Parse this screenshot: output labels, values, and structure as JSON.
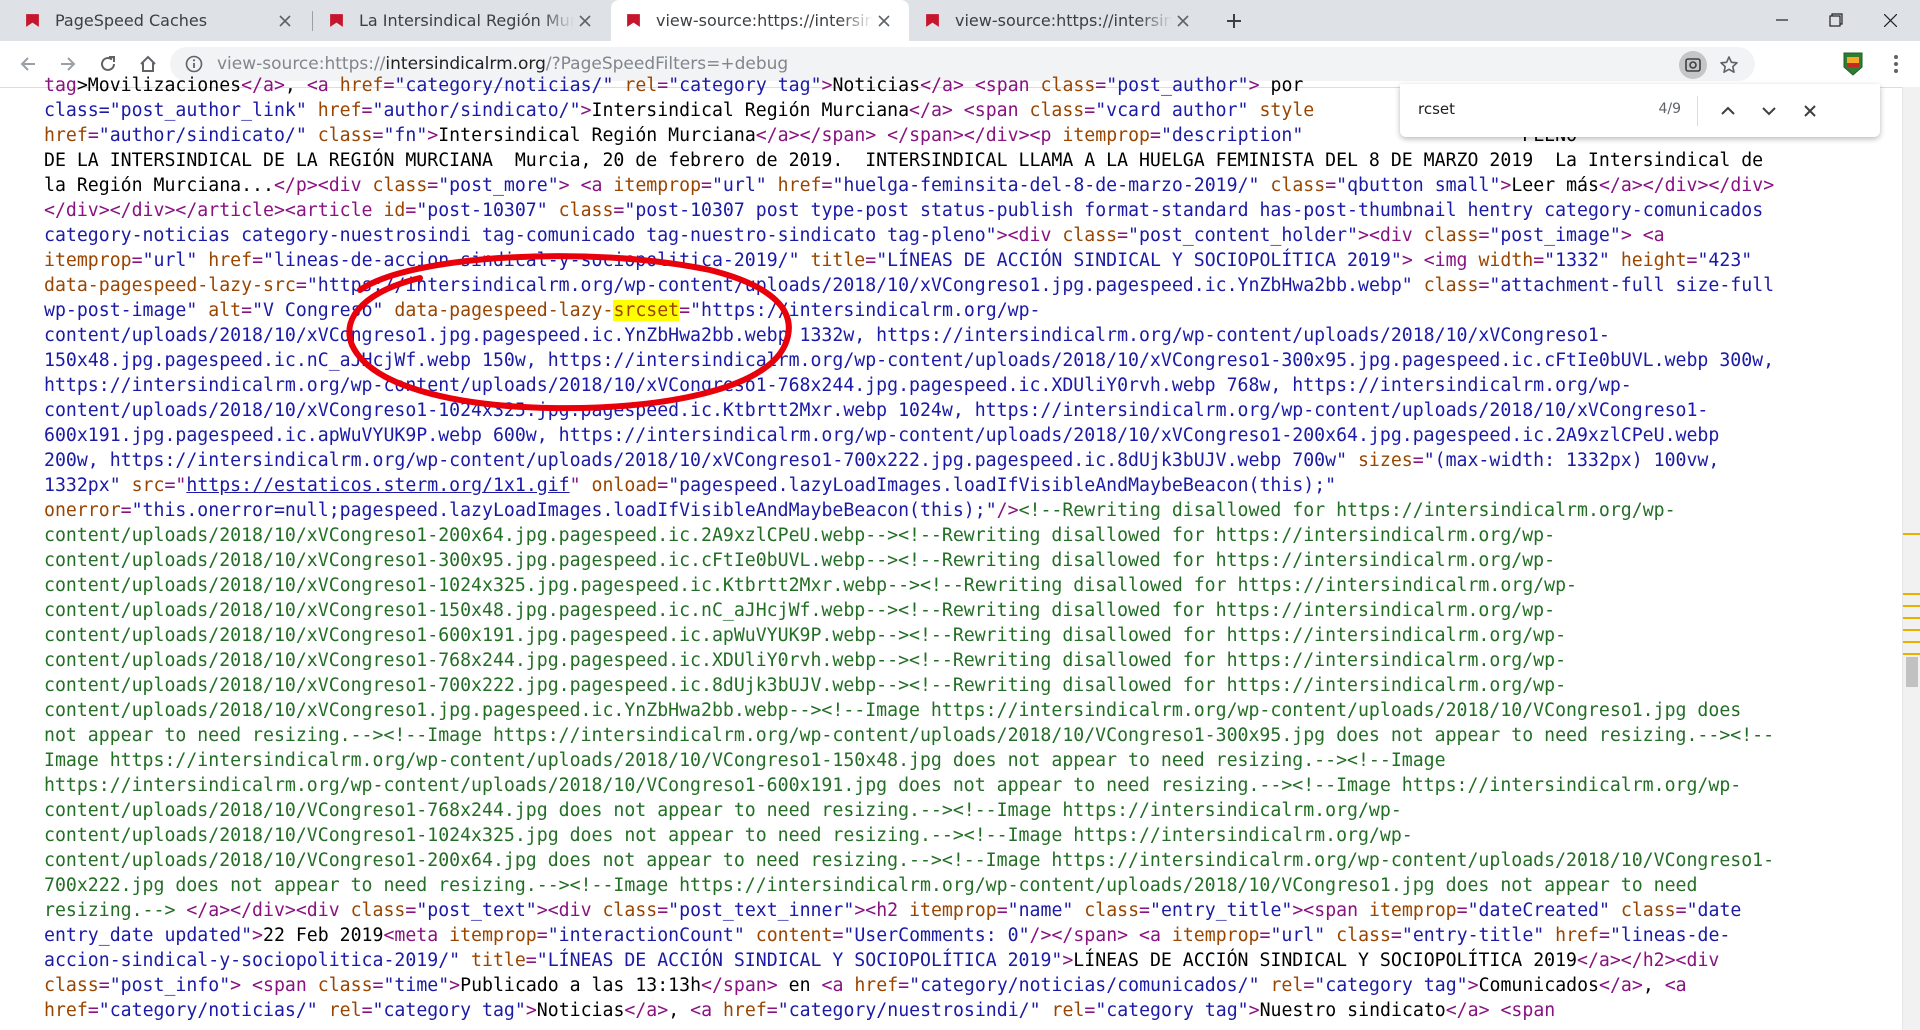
{
  "tabs": [
    {
      "title": "PageSpeed Caches",
      "active": false
    },
    {
      "title": "La Intersindical Región Murciana",
      "active": false
    },
    {
      "title": "view-source:https://intersindicalrm.org/?PageSpeedFilters=+debug",
      "active": true
    },
    {
      "title": "view-source:https://intersindicalrm.org/",
      "active": false
    }
  ],
  "omnibox": {
    "scheme": "view-source:https://",
    "host": "intersindicalrm.org",
    "path": "/?PageSpeedFilters=+debug"
  },
  "find": {
    "query": "rcset",
    "count": "4/9"
  },
  "colors": {
    "tag": "#881280",
    "attr": "#994500",
    "value": "#1a1aa6",
    "comment": "#236e25",
    "highlight": "#ffff00",
    "annotation": "#e8000b",
    "favicon": "#c5162e"
  },
  "icons": [
    "favicon",
    "close-icon",
    "plus-icon",
    "minimize-icon",
    "maximize-icon",
    "back-icon",
    "forward-icon",
    "reload-icon",
    "home-icon",
    "info-icon",
    "lens-icon",
    "star-icon",
    "extension-icon",
    "menu-icon",
    "chevron-up-icon",
    "chevron-down-icon"
  ],
  "source_lines": [
    [
      [
        "t",
        "tag"
      ],
      [
        "tx",
        "&gt;Movilizaciones"
      ],
      [
        "t",
        "&lt;/a&gt;"
      ],
      [
        "tx",
        ", "
      ],
      [
        "t",
        "&lt;a "
      ],
      [
        "a",
        "href"
      ],
      [
        "t",
        "="
      ],
      [
        "v",
        "\"category/noticias/\""
      ],
      [
        "a",
        " rel"
      ],
      [
        "t",
        "="
      ],
      [
        "v",
        "\"category tag\""
      ],
      [
        "t",
        "&gt;"
      ],
      [
        "tx",
        "Noticias"
      ],
      [
        "t",
        "&lt;/a&gt; &lt;span "
      ],
      [
        "a",
        "class"
      ],
      [
        "t",
        "="
      ],
      [
        "v",
        "\"post_author\""
      ],
      [
        "t",
        "&gt; "
      ],
      [
        "tx",
        "por"
      ]
    ],
    [
      [
        "v",
        "class=\"post_author_link\""
      ],
      [
        "a",
        " href"
      ],
      [
        "t",
        "="
      ],
      [
        "v",
        "\"author/sindicato/\""
      ],
      [
        "t",
        "&gt;"
      ],
      [
        "tx",
        "Intersindical Región Murciana"
      ],
      [
        "t",
        "&lt;/a&gt; &lt;span "
      ],
      [
        "a",
        "class"
      ],
      [
        "t",
        "="
      ],
      [
        "v",
        "\"vcard author\""
      ],
      [
        "a",
        " style"
      ]
    ],
    [
      [
        "a",
        "href"
      ],
      [
        "t",
        "="
      ],
      [
        "v",
        "\"author/sindicato/\""
      ],
      [
        "a",
        " class"
      ],
      [
        "t",
        "="
      ],
      [
        "v",
        "\"fn\""
      ],
      [
        "t",
        "&gt;"
      ],
      [
        "tx",
        "Intersindical Región Murciana"
      ],
      [
        "t",
        "&lt;/a&gt;&lt;/span&gt; &lt;/span&gt;&lt;/div&gt;&lt;p "
      ],
      [
        "a",
        "itemprop"
      ],
      [
        "t",
        "="
      ],
      [
        "v",
        "\"description\""
      ],
      [
        "tx",
        "                    PLENO"
      ]
    ],
    [
      [
        "tx",
        "DE LA INTERSINDICAL DE LA REGIÓN MURCIANA  Murcia, 20 de febrero de 2019.  INTERSINDICAL LLAMA A LA HUELGA FEMINISTA DEL 8 DE MARZO 2019  La Intersindical de"
      ]
    ],
    [
      [
        "tx",
        "la Región Murciana..."
      ],
      [
        "t",
        "&lt;/p&gt;&lt;div "
      ],
      [
        "a",
        "class"
      ],
      [
        "t",
        "="
      ],
      [
        "v",
        "\"post_more\""
      ],
      [
        "t",
        "&gt; &lt;a "
      ],
      [
        "a",
        "itemprop"
      ],
      [
        "t",
        "="
      ],
      [
        "v",
        "\"url\""
      ],
      [
        "a",
        " href"
      ],
      [
        "t",
        "="
      ],
      [
        "v",
        "\"huelga-feminsita-del-8-de-marzo-2019/\""
      ],
      [
        "a",
        " class"
      ],
      [
        "t",
        "="
      ],
      [
        "v",
        "\"qbutton small\""
      ],
      [
        "t",
        "&gt;"
      ],
      [
        "tx",
        "Leer más"
      ],
      [
        "t",
        "&lt;/a&gt;&lt;/div&gt;&lt;/div&gt;"
      ]
    ],
    [
      [
        "t",
        "&lt;/div&gt;&lt;/div&gt;&lt;/article&gt;&lt;article "
      ],
      [
        "a",
        "id"
      ],
      [
        "t",
        "="
      ],
      [
        "v",
        "\"post-10307\""
      ],
      [
        "a",
        " class"
      ],
      [
        "t",
        "="
      ],
      [
        "v",
        "\"post-10307 post type-post status-publish format-standard has-post-thumbnail hentry category-comunicados"
      ]
    ],
    [
      [
        "v",
        "category-noticias category-nuestrosindi tag-comunicado tag-nuestro-sindicato tag-pleno\""
      ],
      [
        "t",
        "&gt;&lt;div "
      ],
      [
        "a",
        "class"
      ],
      [
        "t",
        "="
      ],
      [
        "v",
        "\"post_content_holder\""
      ],
      [
        "t",
        "&gt;&lt;div "
      ],
      [
        "a",
        "class"
      ],
      [
        "t",
        "="
      ],
      [
        "v",
        "\"post_image\""
      ],
      [
        "t",
        "&gt; &lt;a"
      ]
    ],
    [
      [
        "a",
        "itemprop"
      ],
      [
        "t",
        "="
      ],
      [
        "v",
        "\"url\""
      ],
      [
        "a",
        " href"
      ],
      [
        "t",
        "="
      ],
      [
        "v",
        "\"lineas-de-accion-sindical-y-sociopolitica-2019/\""
      ],
      [
        "a",
        " title"
      ],
      [
        "t",
        "="
      ],
      [
        "v",
        "\"LÍNEAS DE ACCIÓN SINDICAL Y SOCIOPOLÍTICA 2019\""
      ],
      [
        "t",
        "&gt; &lt;img "
      ],
      [
        "a",
        "width"
      ],
      [
        "t",
        "="
      ],
      [
        "v",
        "\"1332\""
      ],
      [
        "a",
        " height"
      ],
      [
        "t",
        "="
      ],
      [
        "v",
        "\"423\""
      ]
    ],
    [
      [
        "a",
        "data-pagespeed-lazy-src"
      ],
      [
        "t",
        "="
      ],
      [
        "v",
        "\"https://intersindicalrm.org/wp-content/uploads/2018/10/xVCongreso1.jpg.pagespeed.ic.YnZbHwa2bb.webp\""
      ],
      [
        "a",
        " class"
      ],
      [
        "t",
        "="
      ],
      [
        "v",
        "\"attachment-full size-full"
      ]
    ],
    [
      [
        "v",
        "wp-post-image\""
      ],
      [
        "a",
        " alt"
      ],
      [
        "t",
        "="
      ],
      [
        "v",
        "\"V Congreso\""
      ],
      [
        "a",
        " data-pagespeed-lazy-"
      ],
      [
        "hla",
        "srcset"
      ],
      [
        "t",
        "="
      ],
      [
        "v",
        "\"https://intersindicalrm.org/wp-"
      ]
    ],
    [
      [
        "v",
        "content/uploads/2018/10/xVCongreso1.jpg.pagespeed.ic.YnZbHwa2bb.webp 1332w, https://intersindicalrm.org/wp-content/uploads/2018/10/xVCongreso1-"
      ]
    ],
    [
      [
        "v",
        "150x48.jpg.pagespeed.ic.nC_aJHcjWf.webp 150w, https://intersindicalrm.org/wp-content/uploads/2018/10/xVCongreso1-300x95.jpg.pagespeed.ic.cFtIe0bUVL.webp 300w,"
      ]
    ],
    [
      [
        "v",
        "https://intersindicalrm.org/wp-content/uploads/2018/10/xVCongreso1-768x244.jpg.pagespeed.ic.XDUliY0rvh.webp 768w, https://intersindicalrm.org/wp-"
      ]
    ],
    [
      [
        "v",
        "content/uploads/2018/10/xVCongreso1-1024x325.jpg.pagespeed.ic.Ktbrtt2Mxr.webp 1024w, https://intersindicalrm.org/wp-content/uploads/2018/10/xVCongreso1-"
      ]
    ],
    [
      [
        "v",
        "600x191.jpg.pagespeed.ic.apWuVYUK9P.webp 600w, https://intersindicalrm.org/wp-content/uploads/2018/10/xVCongreso1-200x64.jpg.pagespeed.ic.2A9xzlCPeU.webp"
      ]
    ],
    [
      [
        "v",
        "200w, https://intersindicalrm.org/wp-content/uploads/2018/10/xVCongreso1-700x222.jpg.pagespeed.ic.8dUjk3bUJV.webp 700w\""
      ],
      [
        "a",
        " sizes"
      ],
      [
        "t",
        "="
      ],
      [
        "v",
        "\"(max-width: 1332px) 100vw,"
      ]
    ],
    [
      [
        "v",
        "1332px\""
      ],
      [
        "a",
        " src"
      ],
      [
        "t",
        "=\""
      ],
      [
        "lk",
        "https://estaticos.sterm.org/1x1.gif"
      ],
      [
        "t",
        "\""
      ],
      [
        "a",
        " onload"
      ],
      [
        "t",
        "="
      ],
      [
        "v",
        "\"pagespeed.lazyLoadImages.loadIfVisibleAndMaybeBeacon(this);\""
      ]
    ],
    [
      [
        "a",
        "onerror"
      ],
      [
        "t",
        "="
      ],
      [
        "v",
        "\"this.onerror=null;pagespeed.lazyLoadImages.loadIfVisibleAndMaybeBeacon(this);\""
      ],
      [
        "t",
        "/&gt;"
      ],
      [
        "c",
        "&lt;!--Rewriting disallowed for https://intersindicalrm.org/wp-"
      ]
    ],
    [
      [
        "c",
        "content/uploads/2018/10/xVCongreso1-200x64.jpg.pagespeed.ic.2A9xzlCPeU.webp--&gt;&lt;!--Rewriting disallowed for https://intersindicalrm.org/wp-"
      ]
    ],
    [
      [
        "c",
        "content/uploads/2018/10/xVCongreso1-300x95.jpg.pagespeed.ic.cFtIe0bUVL.webp--&gt;&lt;!--Rewriting disallowed for https://intersindicalrm.org/wp-"
      ]
    ],
    [
      [
        "c",
        "content/uploads/2018/10/xVCongreso1-1024x325.jpg.pagespeed.ic.Ktbrtt2Mxr.webp--&gt;&lt;!--Rewriting disallowed for https://intersindicalrm.org/wp-"
      ]
    ],
    [
      [
        "c",
        "content/uploads/2018/10/xVCongreso1-150x48.jpg.pagespeed.ic.nC_aJHcjWf.webp--&gt;&lt;!--Rewriting disallowed for https://intersindicalrm.org/wp-"
      ]
    ],
    [
      [
        "c",
        "content/uploads/2018/10/xVCongreso1-600x191.jpg.pagespeed.ic.apWuVYUK9P.webp--&gt;&lt;!--Rewriting disallowed for https://intersindicalrm.org/wp-"
      ]
    ],
    [
      [
        "c",
        "content/uploads/2018/10/xVCongreso1-768x244.jpg.pagespeed.ic.XDUliY0rvh.webp--&gt;&lt;!--Rewriting disallowed for https://intersindicalrm.org/wp-"
      ]
    ],
    [
      [
        "c",
        "content/uploads/2018/10/xVCongreso1-700x222.jpg.pagespeed.ic.8dUjk3bUJV.webp--&gt;&lt;!--Rewriting disallowed for https://intersindicalrm.org/wp-"
      ]
    ],
    [
      [
        "c",
        "content/uploads/2018/10/xVCongreso1.jpg.pagespeed.ic.YnZbHwa2bb.webp--&gt;&lt;!--Image https://intersindicalrm.org/wp-content/uploads/2018/10/VCongreso1.jpg does"
      ]
    ],
    [
      [
        "c",
        "not appear to need resizing.--&gt;&lt;!--Image https://intersindicalrm.org/wp-content/uploads/2018/10/VCongreso1-300x95.jpg does not appear to need resizing.--&gt;&lt;!--"
      ]
    ],
    [
      [
        "c",
        "Image https://intersindicalrm.org/wp-content/uploads/2018/10/VCongreso1-150x48.jpg does not appear to need resizing.--&gt;&lt;!--Image"
      ]
    ],
    [
      [
        "c",
        "https://intersindicalrm.org/wp-content/uploads/2018/10/VCongreso1-600x191.jpg does not appear to need resizing.--&gt;&lt;!--Image https://intersindicalrm.org/wp-"
      ]
    ],
    [
      [
        "c",
        "content/uploads/2018/10/VCongreso1-768x244.jpg does not appear to need resizing.--&gt;&lt;!--Image https://intersindicalrm.org/wp-"
      ]
    ],
    [
      [
        "c",
        "content/uploads/2018/10/VCongreso1-1024x325.jpg does not appear to need resizing.--&gt;&lt;!--Image https://intersindicalrm.org/wp-"
      ]
    ],
    [
      [
        "c",
        "content/uploads/2018/10/VCongreso1-200x64.jpg does not appear to need resizing.--&gt;&lt;!--Image https://intersindicalrm.org/wp-content/uploads/2018/10/VCongreso1-"
      ]
    ],
    [
      [
        "c",
        "700x222.jpg does not appear to need resizing.--&gt;&lt;!--Image https://intersindicalrm.org/wp-content/uploads/2018/10/VCongreso1.jpg does not appear to need"
      ]
    ],
    [
      [
        "c",
        "resizing.--&gt;"
      ],
      [
        "t",
        " &lt;/a&gt;&lt;/div&gt;&lt;div "
      ],
      [
        "a",
        "class"
      ],
      [
        "t",
        "="
      ],
      [
        "v",
        "\"post_text\""
      ],
      [
        "t",
        "&gt;&lt;div "
      ],
      [
        "a",
        "class"
      ],
      [
        "t",
        "="
      ],
      [
        "v",
        "\"post_text_inner\""
      ],
      [
        "t",
        "&gt;&lt;h2 "
      ],
      [
        "a",
        "itemprop"
      ],
      [
        "t",
        "="
      ],
      [
        "v",
        "\"name\""
      ],
      [
        "a",
        " class"
      ],
      [
        "t",
        "="
      ],
      [
        "v",
        "\"entry_title\""
      ],
      [
        "t",
        "&gt;&lt;span "
      ],
      [
        "a",
        "itemprop"
      ],
      [
        "t",
        "="
      ],
      [
        "v",
        "\"dateCreated\""
      ],
      [
        "a",
        " class"
      ],
      [
        "t",
        "="
      ],
      [
        "v",
        "\"date"
      ]
    ],
    [
      [
        "v",
        "entry_date updated\""
      ],
      [
        "t",
        "&gt;"
      ],
      [
        "tx",
        "22 Feb 2019"
      ],
      [
        "t",
        "&lt;meta "
      ],
      [
        "a",
        "itemprop"
      ],
      [
        "t",
        "="
      ],
      [
        "v",
        "\"interactionCount\""
      ],
      [
        "a",
        " content"
      ],
      [
        "t",
        "="
      ],
      [
        "v",
        "\"UserComments: 0\""
      ],
      [
        "t",
        "/&gt;&lt;/span&gt; &lt;a "
      ],
      [
        "a",
        "itemprop"
      ],
      [
        "t",
        "="
      ],
      [
        "v",
        "\"url\""
      ],
      [
        "a",
        " class"
      ],
      [
        "t",
        "="
      ],
      [
        "v",
        "\"entry-title\""
      ],
      [
        "a",
        " href"
      ],
      [
        "t",
        "="
      ],
      [
        "v",
        "\"lineas-de-"
      ]
    ],
    [
      [
        "v",
        "accion-sindical-y-sociopolitica-2019/\""
      ],
      [
        "a",
        " title"
      ],
      [
        "t",
        "="
      ],
      [
        "v",
        "\"LÍNEAS DE ACCIÓN SINDICAL Y SOCIOPOLÍTICA 2019\""
      ],
      [
        "t",
        "&gt;"
      ],
      [
        "tx",
        "LÍNEAS DE ACCIÓN SINDICAL Y SOCIOPOLÍTICA 2019"
      ],
      [
        "t",
        "&lt;/a&gt;&lt;/h2&gt;&lt;div"
      ]
    ],
    [
      [
        "a",
        "class"
      ],
      [
        "t",
        "="
      ],
      [
        "v",
        "\"post_info\""
      ],
      [
        "t",
        "&gt; &lt;span "
      ],
      [
        "a",
        "class"
      ],
      [
        "t",
        "="
      ],
      [
        "v",
        "\"time\""
      ],
      [
        "t",
        "&gt;"
      ],
      [
        "tx",
        "Publicado a las 13:13h"
      ],
      [
        "t",
        "&lt;/span&gt;"
      ],
      [
        "tx",
        " en "
      ],
      [
        "t",
        "&lt;a "
      ],
      [
        "a",
        "href"
      ],
      [
        "t",
        "="
      ],
      [
        "v",
        "\"category/noticias/comunicados/\""
      ],
      [
        "a",
        " rel"
      ],
      [
        "t",
        "="
      ],
      [
        "v",
        "\"category tag\""
      ],
      [
        "t",
        "&gt;"
      ],
      [
        "tx",
        "Comunicados"
      ],
      [
        "t",
        "&lt;/a&gt;"
      ],
      [
        "tx",
        ", "
      ],
      [
        "t",
        "&lt;a"
      ]
    ],
    [
      [
        "a",
        "href"
      ],
      [
        "t",
        "="
      ],
      [
        "v",
        "\"category/noticias/\""
      ],
      [
        "a",
        " rel"
      ],
      [
        "t",
        "="
      ],
      [
        "v",
        "\"category tag\""
      ],
      [
        "t",
        "&gt;"
      ],
      [
        "tx",
        "Noticias"
      ],
      [
        "t",
        "&lt;/a&gt;"
      ],
      [
        "tx",
        ", "
      ],
      [
        "t",
        "&lt;a "
      ],
      [
        "a",
        "href"
      ],
      [
        "t",
        "="
      ],
      [
        "v",
        "\"category/nuestrosindi/\""
      ],
      [
        "a",
        " rel"
      ],
      [
        "t",
        "="
      ],
      [
        "v",
        "\"category tag\""
      ],
      [
        "t",
        "&gt;"
      ],
      [
        "tx",
        "Nuestro sindicato"
      ],
      [
        "t",
        "&lt;/a&gt; &lt;span"
      ]
    ]
  ]
}
